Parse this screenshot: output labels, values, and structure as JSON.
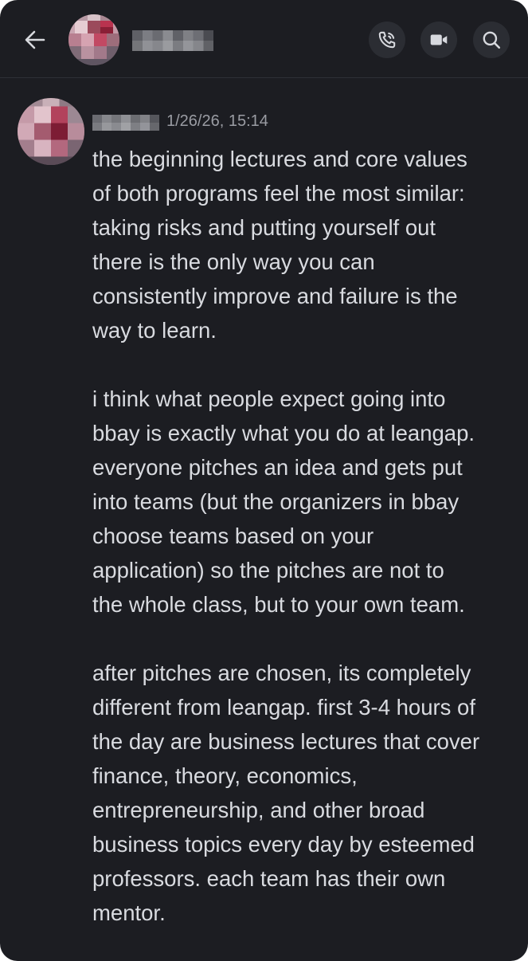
{
  "header": {
    "back_icon": "arrow-left-icon",
    "contact_name": "",
    "call_icon": "phone-call-icon",
    "video_icon": "video-camera-icon",
    "search_icon": "search-icon"
  },
  "message": {
    "author": "",
    "timestamp": "1/26/26, 15:14",
    "paragraphs": [
      "the beginning lectures and core values\nof both programs feel the most similar:\ntaking risks and putting yourself out\nthere is the only way you can\nconsistently improve and failure is the\nway to learn.",
      "i think what people expect going into\nbbay is exactly what you do at leangap.\neveryone pitches an idea and gets put\ninto teams (but the organizers in bbay\nchoose teams based on your\napplication) so the pitches are not to\nthe whole class, but to your own team.",
      "after pitches are chosen, its completely\ndifferent from leangap. first 3-4 hours of\nthe day are business lectures that cover\nfinance, theory, economics,\nentrepreneurship, and other broad\nbusiness topics every day by esteemed\nprofessors. each team has their own\nmentor."
    ]
  },
  "colors": {
    "background": "#1c1d22",
    "header_button": "#2b2d33",
    "text": "#d9dbe0",
    "timestamp": "#9a9ca3",
    "icon": "#d7d9de"
  }
}
